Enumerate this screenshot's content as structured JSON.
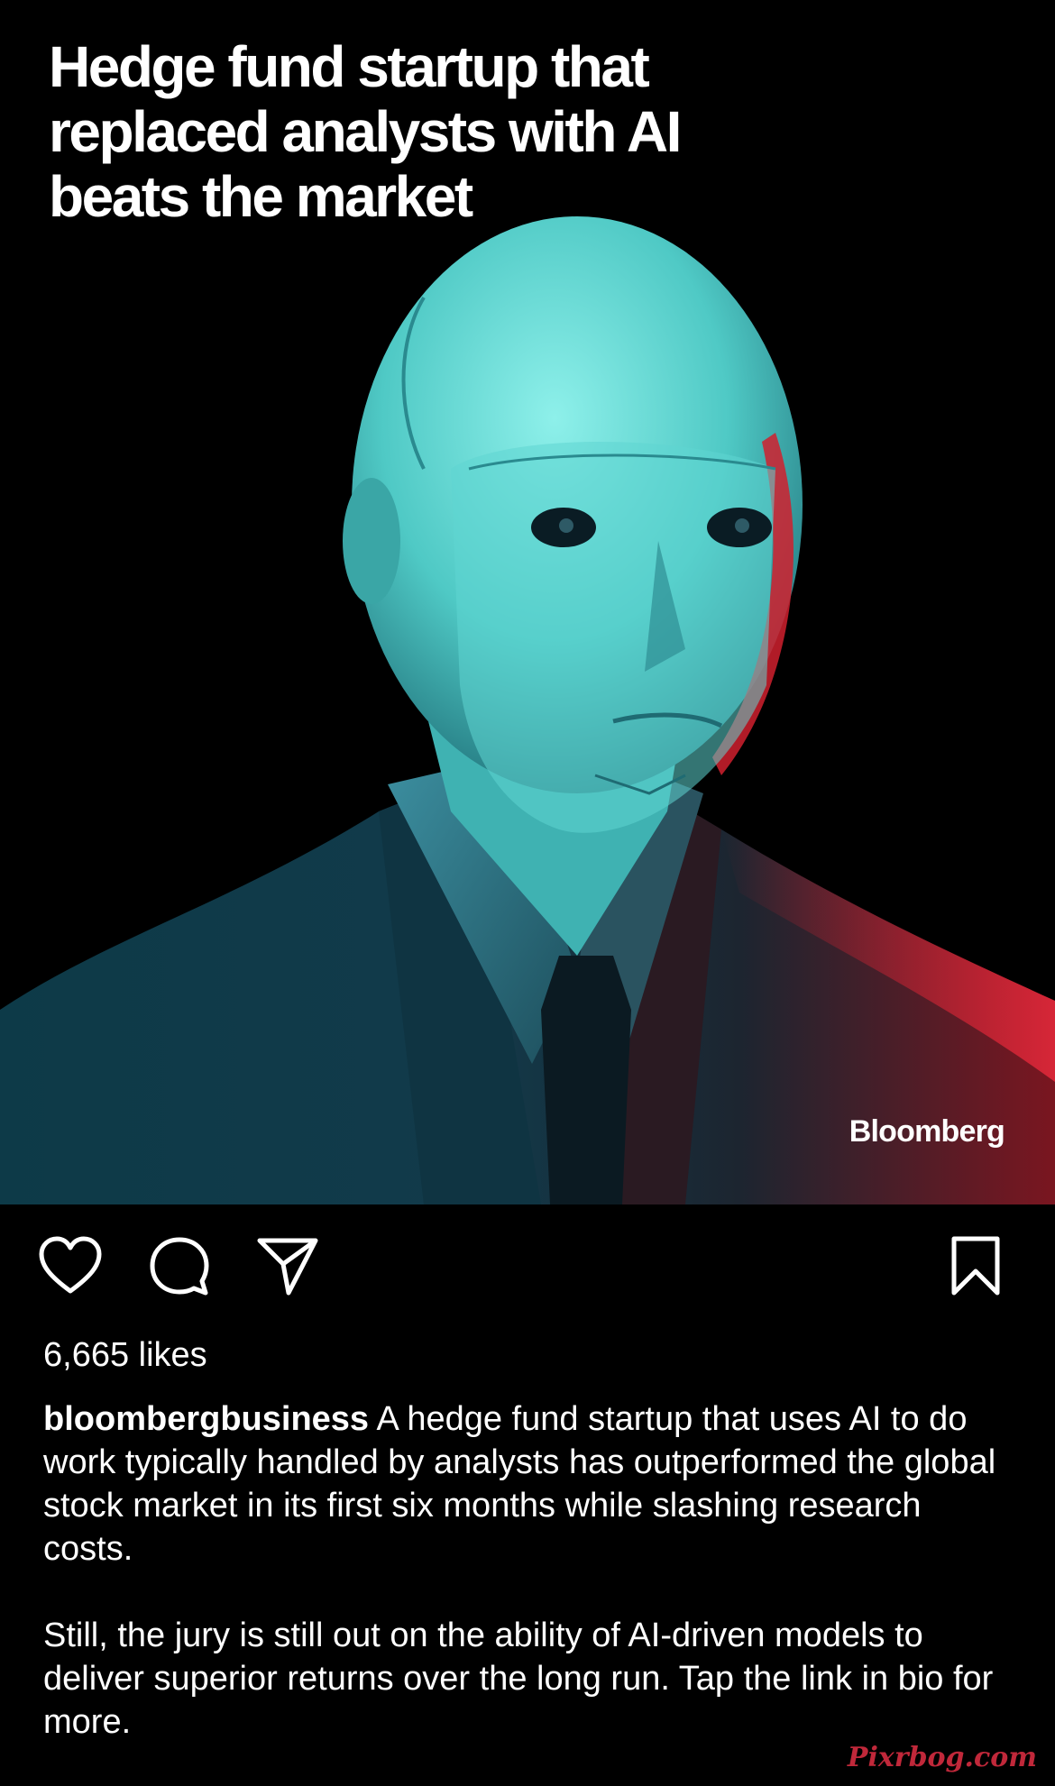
{
  "post": {
    "headline": "Hedge fund startup that\nreplaced analysts with AI\nbeats the market",
    "brand_label": "Bloomberg",
    "image_subject": "robot-in-suit-illustration"
  },
  "actions": {
    "like_icon": "heart-icon",
    "comment_icon": "comment-bubble-icon",
    "share_icon": "paper-plane-icon",
    "save_icon": "bookmark-icon"
  },
  "likes": "6,665 likes",
  "caption": {
    "username": "bloombergbusiness",
    "text": " A hedge fund startup that uses AI to do work typically handled by analysts has outperformed the global stock market in its first six months while slashing research costs.",
    "text2": "Still, the jury is still out on the ability of AI-driven models to deliver superior returns over the long run. Tap the link in bio for more."
  },
  "watermark": "Pixrbog.com",
  "colors": {
    "background": "#000000",
    "robot_teal": "#4fd3cf",
    "accent_red": "#d0202e",
    "watermark": "#c0283a"
  }
}
